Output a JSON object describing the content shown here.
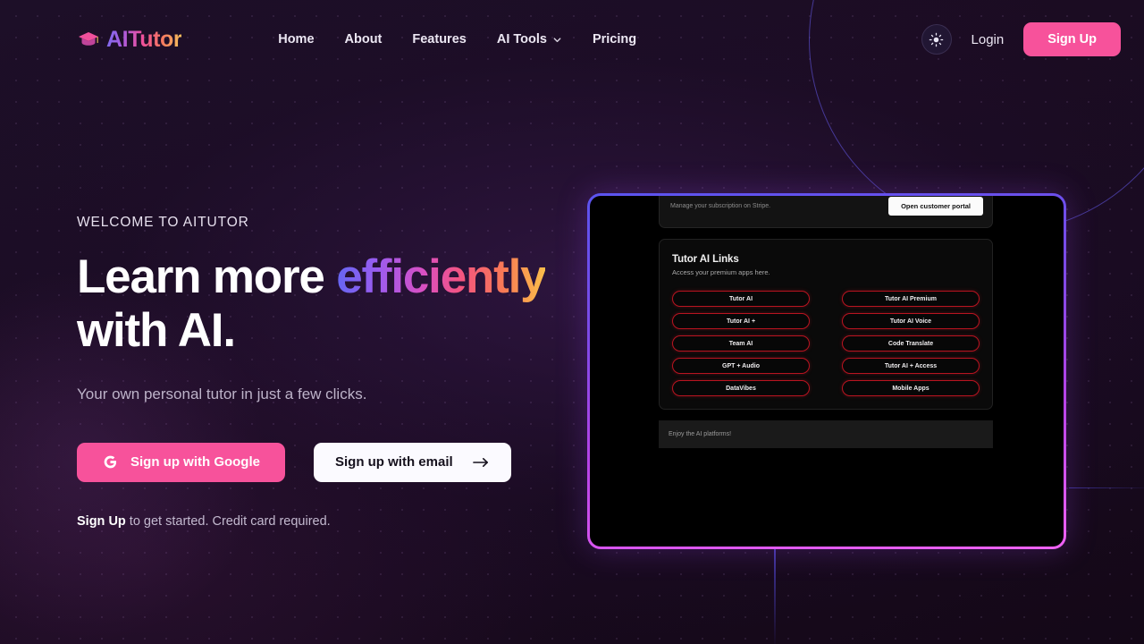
{
  "header": {
    "logo_text": "AITutor",
    "logo_icon": "graduation-cap-icon",
    "nav": [
      {
        "label": "Home",
        "has_chevron": false
      },
      {
        "label": "About",
        "has_chevron": false
      },
      {
        "label": "Features",
        "has_chevron": false
      },
      {
        "label": "AI Tools",
        "has_chevron": true
      },
      {
        "label": "Pricing",
        "has_chevron": false
      }
    ],
    "theme_toggle_icon": "sun-icon",
    "login_label": "Login",
    "signup_label": "Sign Up"
  },
  "hero": {
    "eyebrow": "WELCOME TO AITUTOR",
    "headline_part1": "Learn more ",
    "headline_highlight": "efficiently",
    "headline_part2": "with AI.",
    "subtitle": "Your own personal tutor in just a few clicks.",
    "google_button": {
      "label": "Sign up with Google",
      "icon": "google-g-icon"
    },
    "email_button": {
      "label": "Sign up with email",
      "icon": "arrow-right-icon"
    },
    "note_bold": "Sign Up",
    "note_rest": " to get started. Credit card required."
  },
  "preview": {
    "stripe_text": "Manage your subscription on Stripe.",
    "portal_button": "Open customer portal",
    "links_title": "Tutor AI Links",
    "links_subtitle": "Access your premium apps here.",
    "links": [
      "Tutor AI",
      "Tutor AI Premium",
      "Tutor AI +",
      "Tutor AI Voice",
      "Team AI",
      "Code Translate",
      "GPT + Audio",
      "Tutor AI + Access",
      "DataVibes",
      "Mobile Apps"
    ],
    "footer_text": "Enjoy the AI platforms!"
  },
  "colors": {
    "background": "#190d22",
    "accent_pink": "#f7529b",
    "frame_gradient_start": "#5b54f0",
    "frame_gradient_end": "#f062f5",
    "pill_border": "#b81420",
    "heading_text": "#ffffff"
  }
}
